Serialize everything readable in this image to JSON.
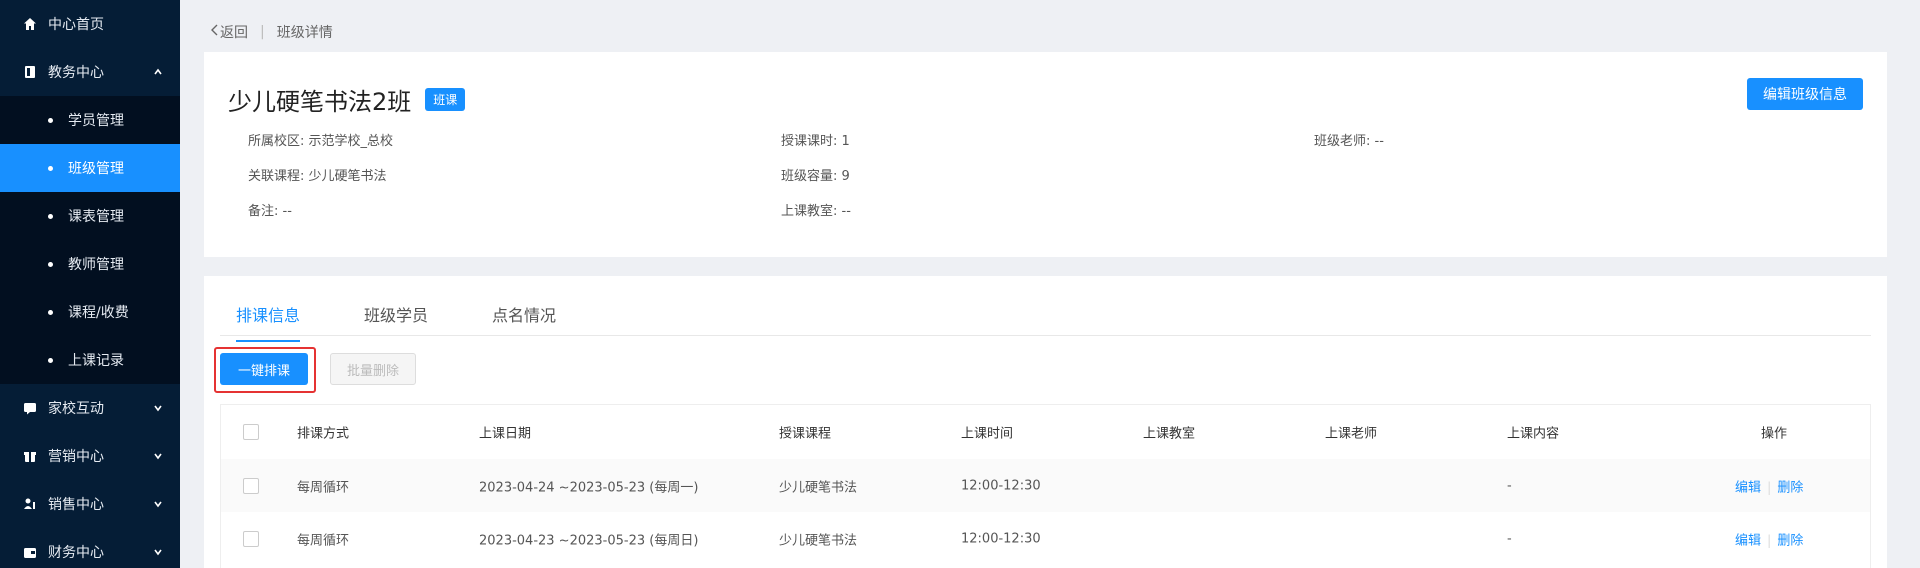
{
  "sidebar": {
    "home": "中心首页",
    "academic": "教务中心",
    "academic_items": [
      "学员管理",
      "班级管理",
      "课表管理",
      "教师管理",
      "课程/收费",
      "上课记录"
    ],
    "home_school": "家校互动",
    "marketing": "营销中心",
    "sales": "销售中心",
    "finance": "财务中心"
  },
  "breadcrumb": {
    "back": "返回",
    "current": "班级详情"
  },
  "class_info": {
    "title": "少儿硬笔书法2班",
    "tag": "班课",
    "edit_button": "编辑班级信息",
    "fields": {
      "campus": "所属校区: 示范学校_总校",
      "hours": "授课课时: 1",
      "teacher": "班级老师: --",
      "course": "关联课程: 少儿硬笔书法",
      "capacity": "班级容量: 9",
      "remark": "备注: --",
      "classroom": "上课教室: --"
    }
  },
  "tabs": [
    "排课信息",
    "班级学员",
    "点名情况"
  ],
  "actions": {
    "schedule": "一键排课",
    "batch_delete": "批量删除"
  },
  "table": {
    "headers": [
      "排课方式",
      "上课日期",
      "授课课程",
      "上课时间",
      "上课教室",
      "上课老师",
      "上课内容",
      "操作"
    ],
    "rows": [
      {
        "mode": "每周循环",
        "date": "2023-04-24 ~2023-05-23 (每周一)",
        "course": "少儿硬笔书法",
        "time": "12:00-12:30",
        "room": "",
        "teacher": "",
        "content": "-",
        "edit": "编辑",
        "delete": "删除"
      },
      {
        "mode": "每周循环",
        "date": "2023-04-23 ~2023-05-23 (每周日)",
        "course": "少儿硬笔书法",
        "time": "12:00-12:30",
        "room": "",
        "teacher": "",
        "content": "-",
        "edit": "编辑",
        "delete": "删除"
      }
    ]
  },
  "colors": {
    "primary": "#1890ff",
    "sidebar_bg": "#051d36",
    "highlight": "#e53333"
  }
}
